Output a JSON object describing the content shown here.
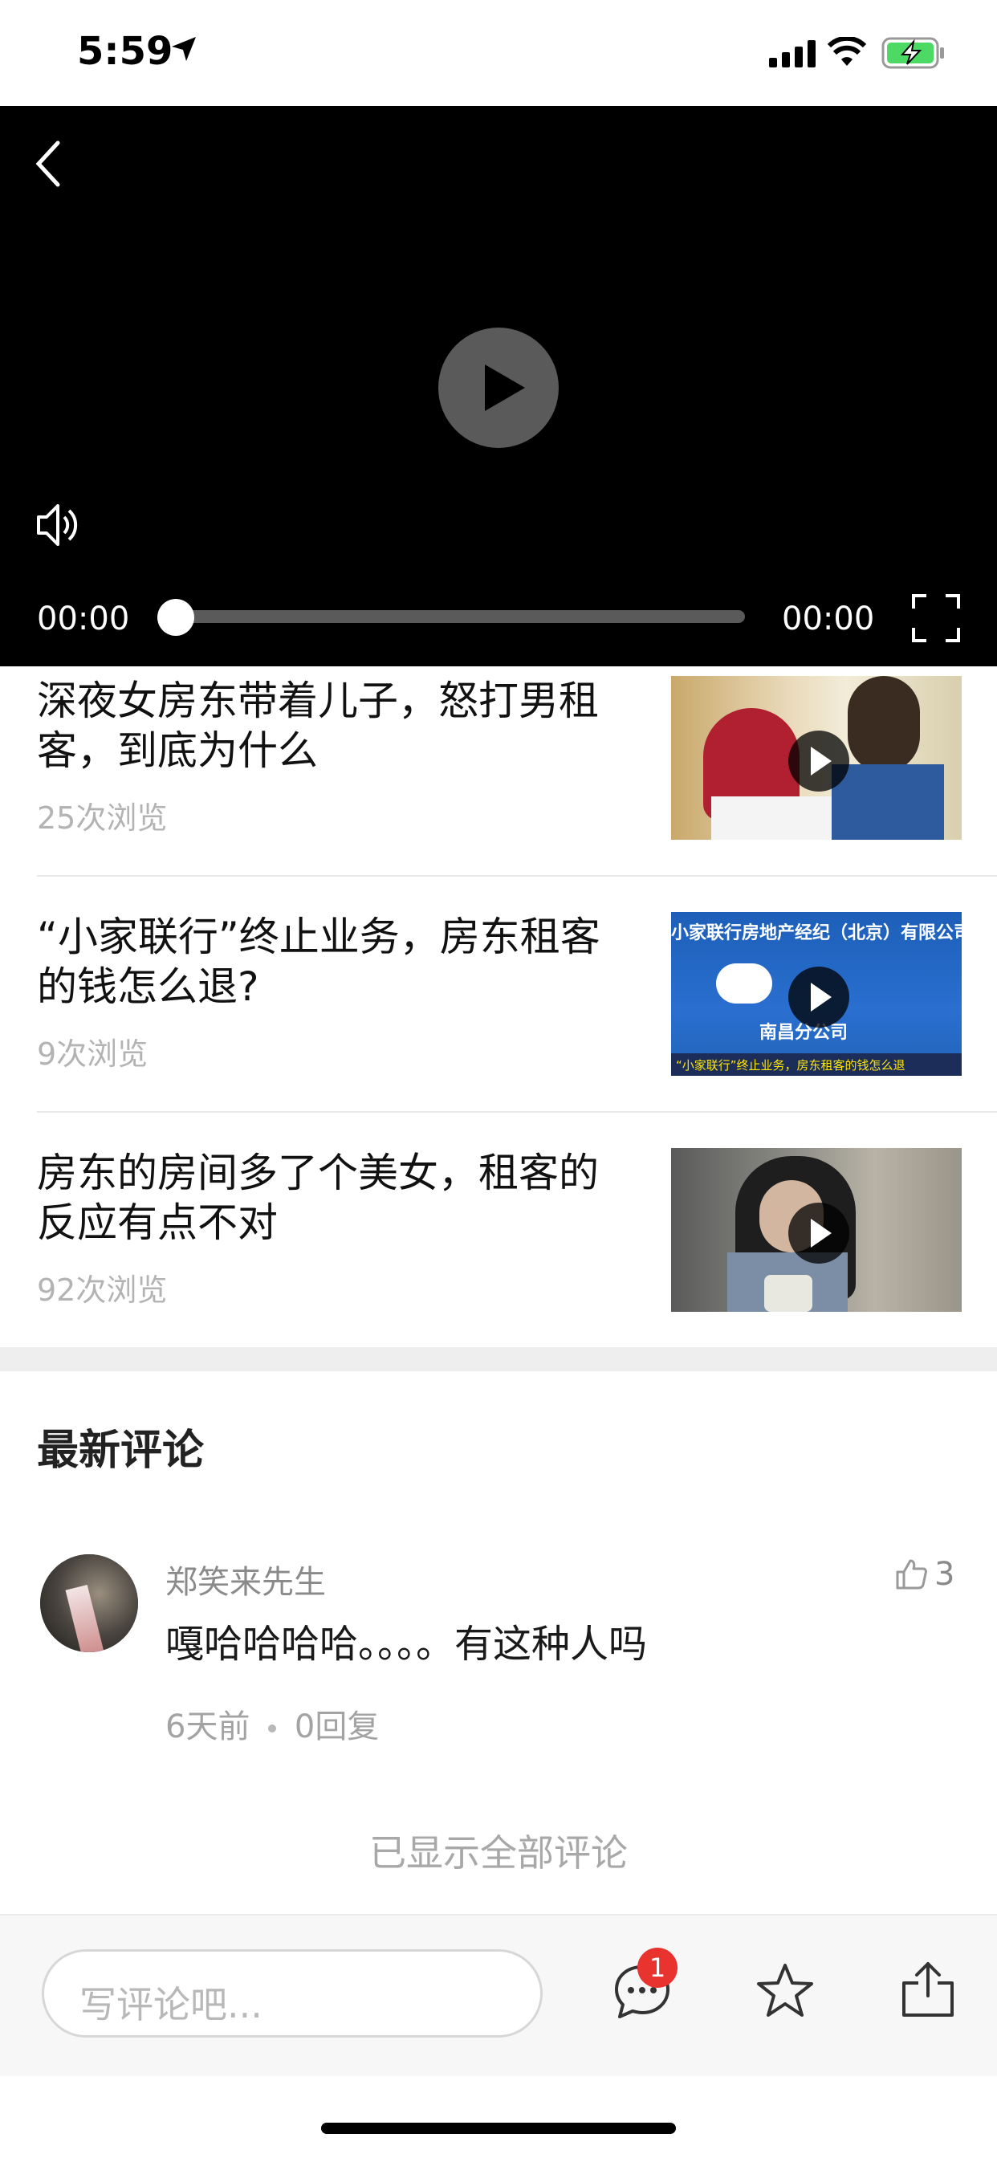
{
  "status_bar": {
    "time": "5:59"
  },
  "video": {
    "current_time": "00:00",
    "total_time": "00:00",
    "progress": 0
  },
  "related": [
    {
      "title": "深夜女房东带着儿子，怒打男租客，到底为什么",
      "views": "25次浏览"
    },
    {
      "title": "“小家联行”终止业务，房东租客的钱怎么退?",
      "views": "9次浏览"
    },
    {
      "title": "房东的房间多了个美女，租客的反应有点不对",
      "views": "92次浏览"
    }
  ],
  "thumb2_text": {
    "banner": "小家联行房地产经纪（北京）有限公司",
    "branch": "南昌分公司",
    "caption": "“小家联行”终止业务，房东租客的钱怎么退"
  },
  "comments": {
    "title": "最新评论",
    "items": [
      {
        "user": "郑笑来先生",
        "likes": "3",
        "text": "嘎哈哈哈哈。。。。有这种人吗",
        "time": "6天前",
        "replies": "0回复"
      }
    ],
    "all_shown": "已显示全部评论"
  },
  "bottom_bar": {
    "input_placeholder": "写评论吧...",
    "badge": "1"
  }
}
